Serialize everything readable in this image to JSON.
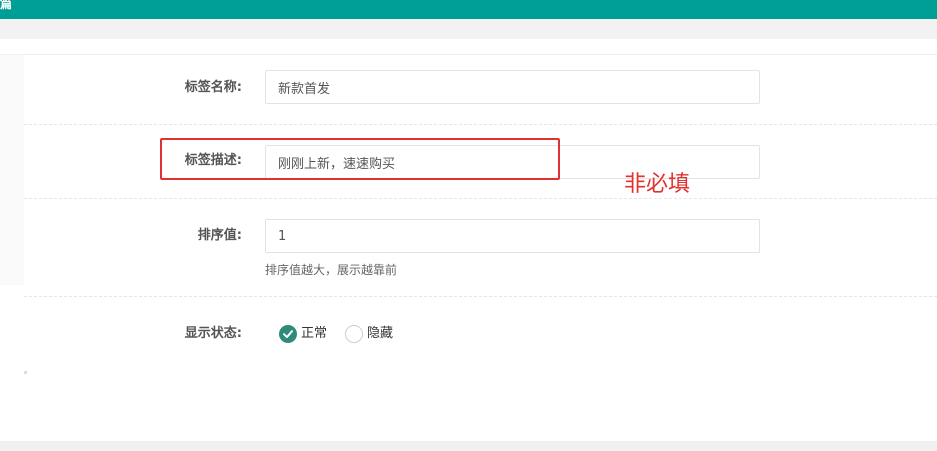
{
  "header": {
    "title_fragment": "篇"
  },
  "form": {
    "name_label": "标签名称:",
    "name_value": "新款首发",
    "desc_label": "标签描述:",
    "desc_value": "刚刚上新，速速购买",
    "sort_label": "排序值:",
    "sort_value": "1",
    "sort_hint": "排序值越大，展示越靠前",
    "status_label": "显示状态:",
    "status_options": [
      {
        "label": "正常",
        "checked": true
      },
      {
        "label": "隐藏",
        "checked": false
      }
    ]
  },
  "annotation": {
    "note": "非必填",
    "color": "#e0322f"
  },
  "colors": {
    "brand": "#009f95",
    "radio_checked": "#2e8b7a"
  },
  "icons": [
    "check-icon"
  ]
}
